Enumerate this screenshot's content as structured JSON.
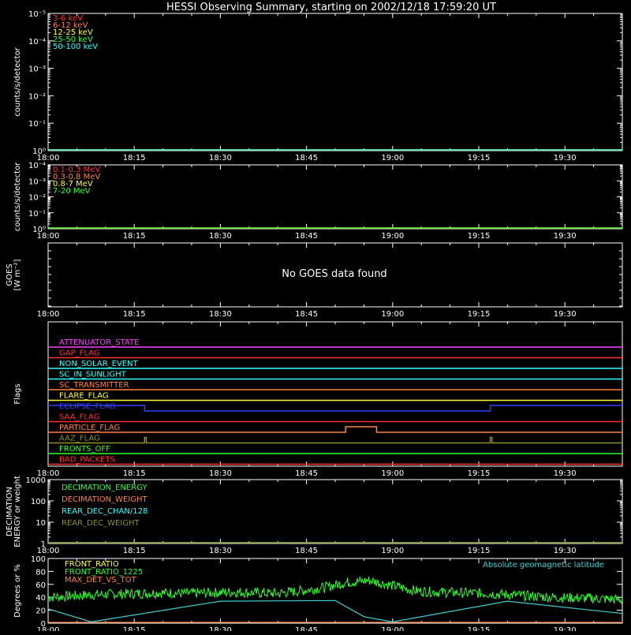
{
  "title": "HESSI Observing Summary, starting on 2002/12/18 17:59:20 UT",
  "time_axis": {
    "start_min": 0,
    "end_min": 100,
    "ticks": [
      {
        "label": "18:00",
        "t": 0
      },
      {
        "label": "18:15",
        "t": 15
      },
      {
        "label": "18:30",
        "t": 30
      },
      {
        "label": "18:45",
        "t": 45
      },
      {
        "label": "19:00",
        "t": 60
      },
      {
        "label": "19:15",
        "t": 75
      },
      {
        "label": "19:30",
        "t": 90
      }
    ]
  },
  "chart_data": [
    {
      "type": "line",
      "id": "hxr",
      "ylabel": "counts/s/detector",
      "yscale": "log",
      "ylim": [
        1,
        100000
      ],
      "ytick_labels": [
        "10⁰",
        "10⁻¹",
        "10⁻²",
        "10⁻³",
        "10⁻⁴",
        "10⁻⁵"
      ],
      "series": [
        {
          "name": "3-6 keV",
          "color": "#ff3030",
          "values": [
            1,
            1
          ]
        },
        {
          "name": "6-12 keV",
          "color": "#ff8040",
          "values": [
            1,
            1
          ]
        },
        {
          "name": "12-25 keV",
          "color": "#ffff30",
          "values": [
            1,
            1
          ]
        },
        {
          "name": "25-50 keV",
          "color": "#30ff30",
          "values": [
            1,
            1
          ]
        },
        {
          "name": "50-100 keV",
          "color": "#30ffff",
          "values": [
            1,
            1
          ]
        }
      ]
    },
    {
      "type": "line",
      "id": "gamma",
      "ylabel": "counts/s/detector",
      "yscale": "log",
      "ylim": [
        1,
        10000
      ],
      "ytick_labels": [
        "10⁰",
        "10⁻¹",
        "10⁻²",
        "10⁻³",
        "10⁻⁴"
      ],
      "series": [
        {
          "name": "0.1-0.3 MeV",
          "color": "#ff3030",
          "values": [
            1,
            1
          ]
        },
        {
          "name": "0.3-0.8 MeV",
          "color": "#ff8040",
          "values": [
            1,
            1
          ]
        },
        {
          "name": "0.8-7 MeV",
          "color": "#ffff30",
          "values": [
            1,
            1
          ]
        },
        {
          "name": "7-20 MeV",
          "color": "#30ff30",
          "values": [
            1,
            1
          ]
        }
      ]
    },
    {
      "type": "line",
      "id": "goes",
      "ylabel": "GOES",
      "ylabel2": "[W m⁻²]",
      "message": "No GOES data found"
    },
    {
      "type": "line",
      "id": "flags",
      "ylabel": "Flags",
      "series": [
        {
          "name": "ATTENUATOR_STATE",
          "color": "#ff40ff",
          "segments": [
            [
              0,
              100,
              0
            ]
          ]
        },
        {
          "name": "GAP_FLAG",
          "color": "#ff3030",
          "segments": [
            [
              0,
              100,
              0
            ]
          ]
        },
        {
          "name": "NON_SOLAR_EVENT",
          "color": "#30ffff",
          "segments": [
            [
              0,
              100,
              0
            ]
          ]
        },
        {
          "name": "SC_IN_SUNLIGHT",
          "color": "#30ffff",
          "segments": [
            [
              0,
              100,
              0
            ]
          ]
        },
        {
          "name": "SC_TRANSMITTER",
          "color": "#ff8040",
          "segments": [
            [
              0,
              100,
              0
            ]
          ]
        },
        {
          "name": "FLARE_FLAG",
          "color": "#ffff30",
          "segments": [
            [
              0,
              100,
              0
            ]
          ]
        },
        {
          "name": "ECLIPSE_FLAG",
          "color": "#3040ff",
          "segments": [
            [
              0,
              16.8,
              1
            ],
            [
              16.8,
              77,
              0
            ],
            [
              77,
              100,
              1
            ]
          ]
        },
        {
          "name": "SAA_FLAG",
          "color": "#ff3030",
          "segments": [
            [
              0,
              100,
              0
            ]
          ]
        },
        {
          "name": "PARTICLE_FLAG",
          "color": "#ff8040",
          "segments": [
            [
              0,
              51.8,
              0
            ],
            [
              51.8,
              57.2,
              1
            ],
            [
              57.2,
              57.8,
              0
            ],
            [
              57.8,
              100,
              0
            ]
          ]
        },
        {
          "name": "AAZ_FLAG",
          "color": "#909020",
          "segments": [
            [
              0,
              16.8,
              0
            ],
            [
              16.8,
              17.1,
              1
            ],
            [
              17.1,
              77,
              0
            ],
            [
              77,
              77.3,
              1
            ],
            [
              77.3,
              100,
              0
            ]
          ]
        },
        {
          "name": "FRONTS_OFF",
          "color": "#30ff30",
          "segments": [
            [
              0,
              100,
              0
            ]
          ]
        },
        {
          "name": "BAD_PACKETS",
          "color": "#ff3030",
          "segments": [
            [
              0,
              100,
              0
            ]
          ]
        }
      ]
    },
    {
      "type": "line",
      "id": "decimation",
      "ylabel": "DECIMATION",
      "ylabel2": "ENERGY or weight",
      "yscale": "log",
      "ylim": [
        1,
        1000
      ],
      "ytick_labels": [
        "1",
        "10",
        "100",
        "1000"
      ],
      "series": [
        {
          "name": "DECIMATION_ENERGY",
          "color": "#30ff30",
          "values": [
            1,
            1
          ]
        },
        {
          "name": "DECIMATION_WEIGHT",
          "color": "#ff8040",
          "values": [
            1,
            1
          ]
        },
        {
          "name": "REAR_DEC_CHAN/128",
          "color": "#30ffff",
          "values": [
            1,
            1
          ]
        },
        {
          "name": "REAR_DEC_WEIGHT",
          "color": "#909020",
          "values": [
            1,
            1
          ]
        }
      ]
    },
    {
      "type": "line",
      "id": "ratio",
      "ylabel": "Degrees or %",
      "ylim": [
        0,
        100
      ],
      "ytick_labels": [
        "0",
        "20",
        "40",
        "60",
        "80",
        "100"
      ],
      "annotation": "Absolute geomagnetic latitude",
      "series": [
        {
          "name": "FRONT_RATIO",
          "color": "#ffff30"
        },
        {
          "name": "FRONT_RATIO_1225",
          "color": "#30ff30",
          "x": [
            0,
            4,
            8,
            12,
            16,
            20,
            24,
            28,
            32,
            36,
            40,
            44,
            48,
            52,
            56,
            60,
            64,
            68,
            72,
            76,
            80,
            84,
            88,
            92,
            96,
            100
          ],
          "values": [
            40,
            42,
            44,
            45,
            46,
            47,
            46,
            47,
            48,
            47,
            46,
            50,
            55,
            63,
            66,
            58,
            50,
            48,
            47,
            46,
            44,
            42,
            40,
            39,
            38,
            36
          ]
        },
        {
          "name": "MAX_DET_VS_TOT",
          "color": "#ff8040",
          "values": [
            0,
            0
          ]
        },
        {
          "name": "geomagnetic",
          "color": "#40d0d0",
          "x": [
            0,
            7.5,
            30,
            50,
            55,
            60,
            80,
            100
          ],
          "values": [
            22,
            2,
            34,
            35,
            10,
            2,
            34,
            15
          ]
        }
      ]
    }
  ]
}
